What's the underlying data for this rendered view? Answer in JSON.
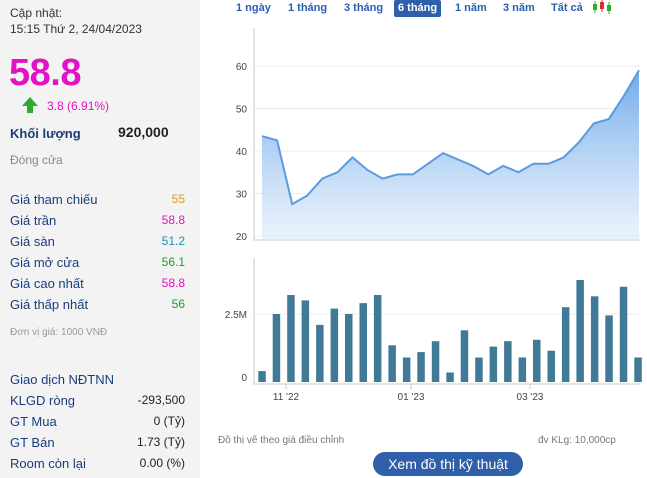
{
  "info": {
    "updated_label": "Cập nhật:",
    "updated_time": "15:15 Thứ 2, 24/04/2023",
    "price": "58.8",
    "change": "3.8 (6.91%)",
    "volume_label": "Khối lượng",
    "volume_value": "920,000",
    "close_label": "Đóng cửa"
  },
  "stats": [
    {
      "label": "Giá tham chiếu",
      "value": "55",
      "color": "#e8951c"
    },
    {
      "label": "Giá trần",
      "value": "58.8",
      "color": "#e312c4"
    },
    {
      "label": "Giá sàn",
      "value": "51.2",
      "color": "#1a8fbf"
    },
    {
      "label": "Giá mở cửa",
      "value": "56.1",
      "color": "#1a9b2a"
    },
    {
      "label": "Giá cao nhất",
      "value": "58.8",
      "color": "#e312c4"
    },
    {
      "label": "Giá thấp nhất",
      "value": "56",
      "color": "#1a9b2a"
    }
  ],
  "unit_note": "Đơn vị giá: 1000 VNĐ",
  "foreign": {
    "title": "Giao dịch NĐTNN",
    "rows": [
      {
        "label": "KLGD ròng",
        "value": "-293,500"
      },
      {
        "label": "GT Mua",
        "value": "0 (Tỷ)"
      },
      {
        "label": "GT Bán",
        "value": "1.73 (Tỷ)"
      },
      {
        "label": "Room còn lại",
        "value": "0.00 (%)"
      }
    ]
  },
  "tabs": [
    {
      "label": "1 ngày",
      "active": false
    },
    {
      "label": "1 tháng",
      "active": false
    },
    {
      "label": "3 tháng",
      "active": false
    },
    {
      "label": "6 tháng",
      "active": true
    },
    {
      "label": "1 năm",
      "active": false
    },
    {
      "label": "3 năm",
      "active": false
    },
    {
      "label": "Tất cả",
      "active": false
    }
  ],
  "colors": {
    "up": "#2eaa2e",
    "accent": "#2f5fa8",
    "area_line": "#5a9ae0",
    "bar": "#417a96"
  },
  "chart_data": [
    {
      "type": "area",
      "ylim": [
        20,
        62
      ],
      "yticks": [
        20,
        30,
        40,
        50,
        60
      ],
      "values": [
        43.5,
        42.5,
        27.5,
        29.5,
        33.5,
        35,
        38.5,
        35.5,
        33.5,
        34.5,
        34.5,
        37,
        39.5,
        38,
        36.5,
        34.5,
        36.5,
        35,
        37,
        37,
        38.5,
        42,
        46.5,
        47.5,
        53,
        59
      ]
    },
    {
      "type": "bar",
      "ylim": [
        0,
        4.5
      ],
      "ytick_labels": [
        "0",
        "2.5M"
      ],
      "yticks": [
        0,
        2.5
      ],
      "x_labels": [
        "11 '22",
        "01 '23",
        "03 '23"
      ],
      "values": [
        0.4,
        2.5,
        3.2,
        3.0,
        2.1,
        2.7,
        2.5,
        2.9,
        3.2,
        1.35,
        0.9,
        1.1,
        1.5,
        0.35,
        1.9,
        0.9,
        1.3,
        1.5,
        0.9,
        1.55,
        1.15,
        2.75,
        3.75,
        3.15,
        2.45,
        3.5,
        0.9
      ]
    }
  ],
  "notes": {
    "left": "Đồ thị vẽ theo giá điều chỉnh",
    "right": "đv KLg: 10,000cp"
  },
  "button": "Xem đồ thị kỹ thuật"
}
